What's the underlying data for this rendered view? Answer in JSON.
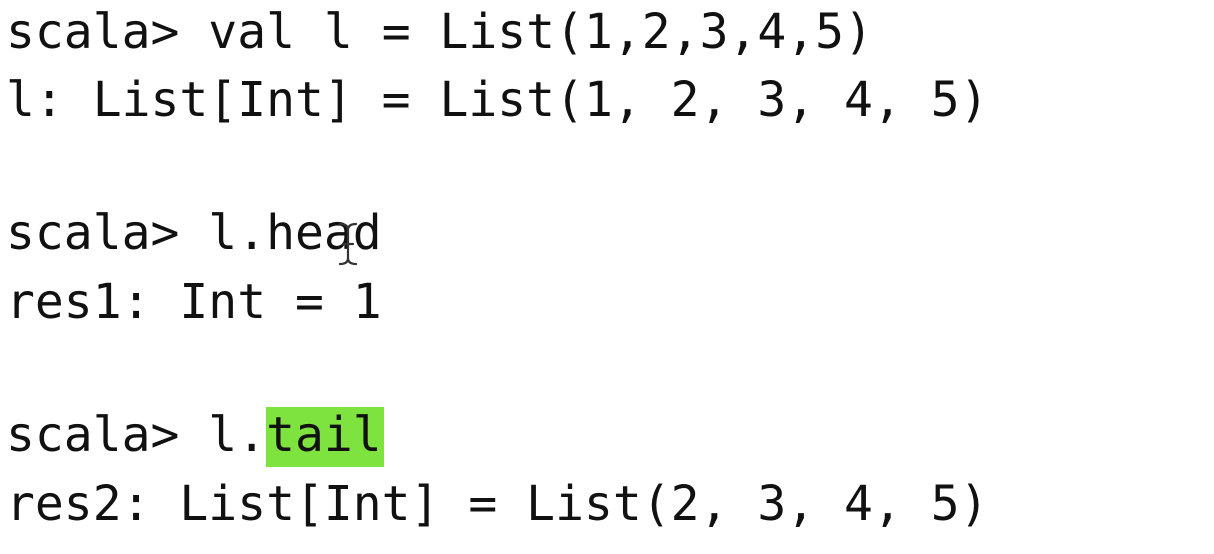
{
  "terminal": {
    "lines": [
      {
        "prompt": "scala> ",
        "input": "val l = List(1,2,3,4,5)"
      },
      {
        "output": "l: List[Int] = List(1, 2, 3, 4, 5)"
      },
      {
        "prompt": "scala> ",
        "input": "l.head"
      },
      {
        "output": "res1: Int = 1"
      },
      {
        "prompt": "scala> ",
        "input_prefix": "l.",
        "input_highlight": "tail"
      },
      {
        "output": "res2: List[Int] = List(2, 3, 4, 5)"
      }
    ],
    "highlight_color": "#7fe33f",
    "text_color": "#111111",
    "background": "#ffffff",
    "cursor_icon": "text-cursor-icon"
  }
}
